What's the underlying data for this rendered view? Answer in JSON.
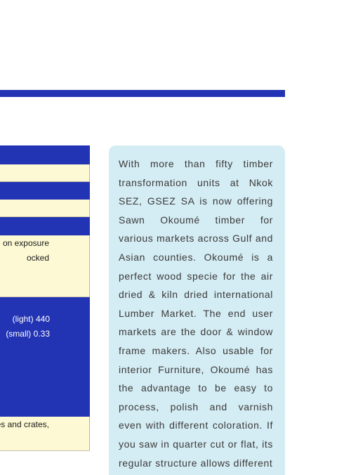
{
  "specs_table": {
    "rows": [
      {
        "style": "blue",
        "lines": []
      },
      {
        "style": "cream",
        "lines": []
      },
      {
        "style": "blue",
        "lines": []
      },
      {
        "style": "cream",
        "lines": []
      },
      {
        "style": "blue",
        "lines": []
      },
      {
        "style": "cream",
        "lines": [
          "on exposure",
          "ocked"
        ]
      },
      {
        "style": "blue",
        "lines": [
          "(light) 440",
          "(small) 0.33"
        ]
      },
      {
        "style": "cream",
        "lines": [
          "oxes and crates,"
        ]
      }
    ]
  },
  "info_panel": {
    "text": "With more than fifty timber transformation units at Nkok SEZ, GSEZ SA is now offering Sawn Okoumé timber for various markets across Gulf and Asian counties. Okoumé is a perfect wood specie for the air dried & kiln dried international Lumber Market. The end user markets are the door & window frame makers. Also usable for interior Furniture, Okoumé has the advantage to be easy to process, polish and varnish even with different coloration. If you saw in quarter cut or flat, its regular structure allows different"
  },
  "colors": {
    "accent_blue": "#2233b4",
    "cream": "#fdf9d4",
    "panel_bg": "#d4ecf3"
  }
}
